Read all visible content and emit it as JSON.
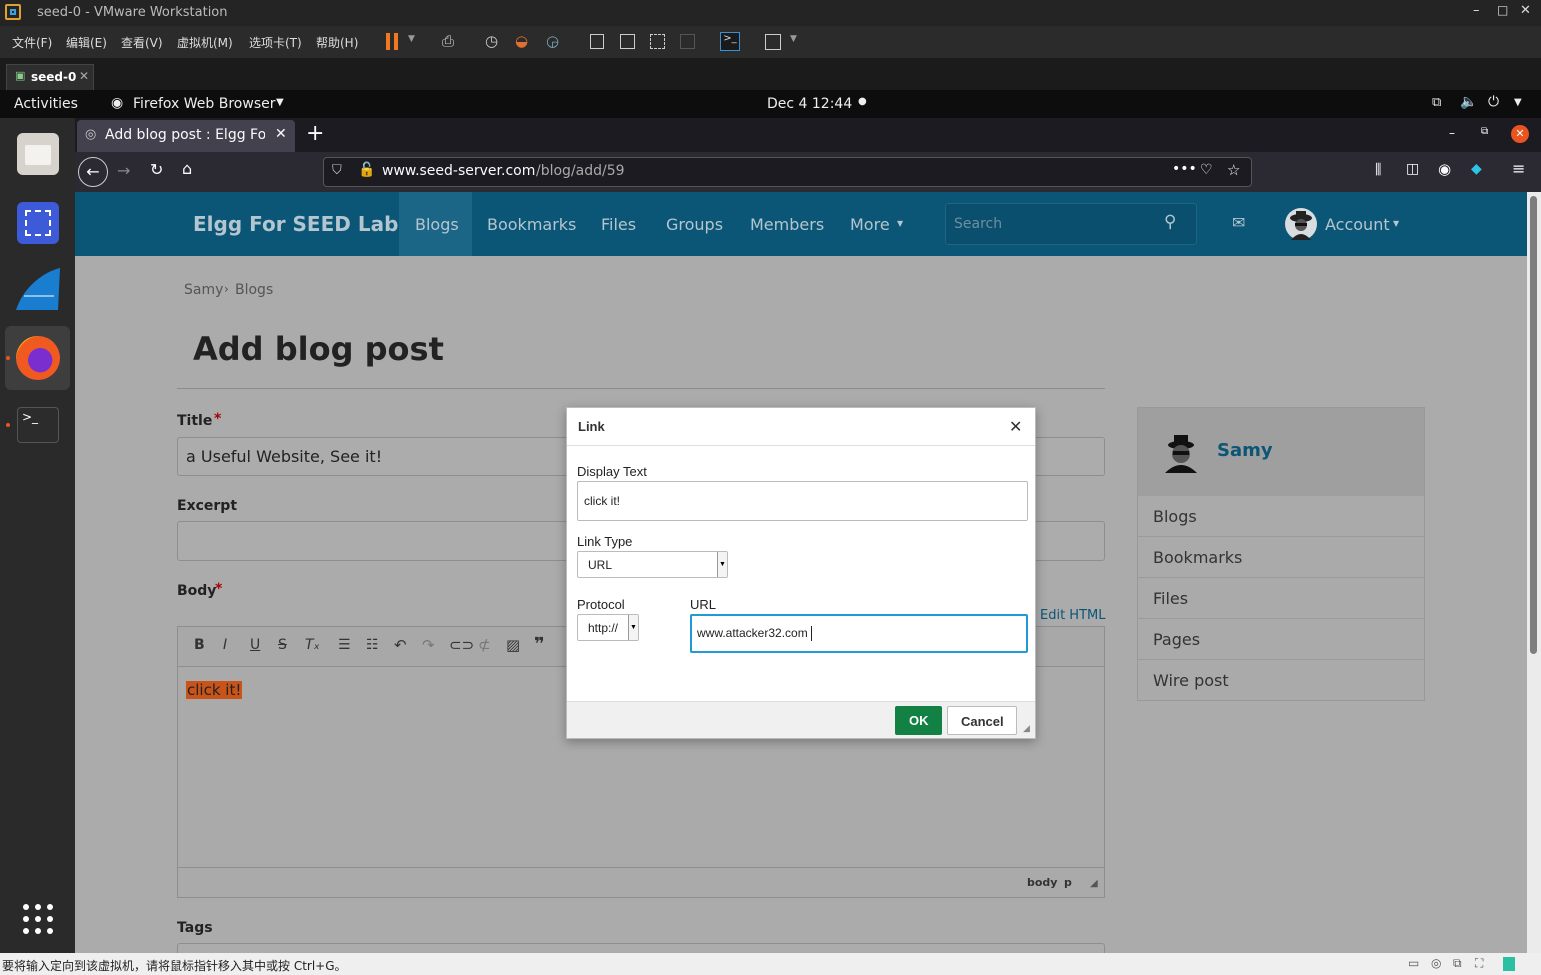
{
  "vm": {
    "title": "seed-0 - VMware Workstation",
    "menu": [
      "文件(F)",
      "编辑(E)",
      "查看(V)",
      "虚拟机(M)",
      "选项卡(T)",
      "帮助(H)"
    ],
    "tab": "seed-0"
  },
  "gnome": {
    "activities": "Activities",
    "app": "Firefox Web Browser",
    "clock": "Dec 4  12:44"
  },
  "firefox": {
    "tab_title": "Add blog post : Elgg For",
    "url_host": "www.seed-server.com",
    "url_path": "/blog/add/59"
  },
  "site": {
    "brand": "Elgg For SEED Labs",
    "nav": [
      "Blogs",
      "Bookmarks",
      "Files",
      "Groups",
      "Members",
      "More"
    ],
    "search_placeholder": "Search",
    "account": "Account",
    "breadcrumb": [
      "Samy",
      "Blogs"
    ],
    "page_title": "Add blog post",
    "title_label": "Title",
    "title_value": "a Useful Website, See it!",
    "excerpt_label": "Excerpt",
    "body_label": "Body",
    "edit_html": "Edit HTML",
    "body_text": "click it!",
    "editor_path": [
      "body",
      "p"
    ],
    "tags_label": "Tags",
    "required_mark": "*"
  },
  "sidebar": {
    "user": "Samy",
    "items": [
      "Blogs",
      "Bookmarks",
      "Files",
      "Pages",
      "Wire post"
    ]
  },
  "dialog": {
    "title": "Link",
    "display_text_label": "Display Text",
    "display_text_value": "click it!",
    "link_type_label": "Link Type",
    "link_type_value": "URL",
    "protocol_label": "Protocol",
    "protocol_value": "http://",
    "url_label": "URL",
    "url_value": "www.attacker32.com",
    "ok": "OK",
    "cancel": "Cancel"
  },
  "status": {
    "message": "要将输入定向到该虚拟机，请将鼠标指针移入其中或按 Ctrl+G。"
  },
  "colors": {
    "elgg_blue": "#0b5576",
    "ok_green": "#138143",
    "focus_blue": "#1f9ad6",
    "highlight": "#c8541a"
  }
}
